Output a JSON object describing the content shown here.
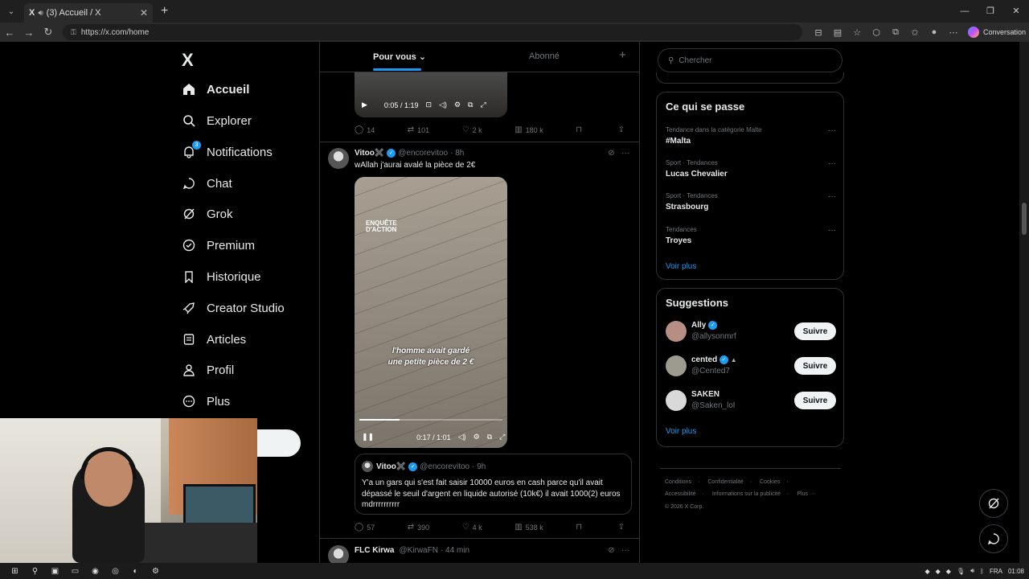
{
  "browser": {
    "tab_title": "(3) Accueil / X",
    "tab_logo": "X",
    "url": "https://x.com/home",
    "conversation_label": "Conversation"
  },
  "nav": {
    "logo": "X",
    "items": [
      {
        "label": "Accueil",
        "icon": "home-icon",
        "bold": true
      },
      {
        "label": "Explorer",
        "icon": "search-icon"
      },
      {
        "label": "Notifications",
        "icon": "bell-icon",
        "badge": "3"
      },
      {
        "label": "Chat",
        "icon": "chat-icon"
      },
      {
        "label": "Grok",
        "icon": "grok-icon"
      },
      {
        "label": "Premium",
        "icon": "premium-icon"
      },
      {
        "label": "Historique",
        "icon": "bookmark-icon"
      },
      {
        "label": "Creator Studio",
        "icon": "rocket-icon"
      },
      {
        "label": "Articles",
        "icon": "article-icon"
      },
      {
        "label": "Profil",
        "icon": "profile-icon"
      },
      {
        "label": "Plus",
        "icon": "more-icon"
      }
    ]
  },
  "feed": {
    "tabs": {
      "for_you": "Pour vous",
      "following": "Abonné"
    },
    "post1": {
      "video_time": "0:05 / 1:19",
      "replies": "14",
      "reposts": "101",
      "likes": "2 k",
      "views": "180 k"
    },
    "post2": {
      "name": "Vitoo✖️",
      "handle": "@encorevitoo",
      "time": "· 8h",
      "text": "wAllah j'aurai avalé la pièce de 2€",
      "video_logo_line1": "ENQUÊTE",
      "video_logo_line2": "D'ACTION",
      "video_caption_line1": "l'homme avait gardé",
      "video_caption_line2": "une petite pièce de 2 €",
      "video_time": "0:17 / 1:01",
      "video_progress": 0.28,
      "quote": {
        "name": "Vitoo✖️",
        "handle": "@encorevitoo",
        "time": "· 9h",
        "text": "Y'a un gars qui s'est fait saisir 10000 euros en cash parce qu'il avait dépassé le seuil d'argent en liquide autorisé (10k€) il avait 1000(2) euros mdrrrrrrrrrr"
      },
      "replies": "57",
      "reposts": "390",
      "likes": "4 k",
      "views": "538 k"
    },
    "post3": {
      "name": "FLC Kirwa",
      "handle": "@KirwaFN",
      "time": "· 44 min"
    }
  },
  "sidebar": {
    "search_placeholder": "Chercher",
    "trends_title": "Ce qui se passe",
    "trends": [
      {
        "meta": "Tendance dans la catégorie Malte",
        "name": "#Malta"
      },
      {
        "meta": "Sport · Tendances",
        "name": "Lucas Chevalier"
      },
      {
        "meta": "Sport · Tendances",
        "name": "Strasbourg"
      },
      {
        "meta": "Tendances",
        "name": "Troyes"
      }
    ],
    "see_more": "Voir plus",
    "suggestions_title": "Suggestions",
    "suggestions": [
      {
        "name": "Ally",
        "handle": "@allysonmrf",
        "follow": "Suivre"
      },
      {
        "name": "cented",
        "handle": "@Cented7",
        "follow": "Suivre"
      },
      {
        "name": "SAKEN",
        "handle": "@Saken_lol",
        "follow": "Suivre"
      }
    ],
    "footer": {
      "links1": [
        "Conditions",
        "Confidentialité",
        "Cookies"
      ],
      "links2": [
        "Accessibilité",
        "Informations sur la publicité",
        "Plus ···"
      ],
      "copyright": "© 2026 X Corp."
    }
  },
  "taskbar": {
    "lang": "FRA",
    "time": "01:08"
  }
}
